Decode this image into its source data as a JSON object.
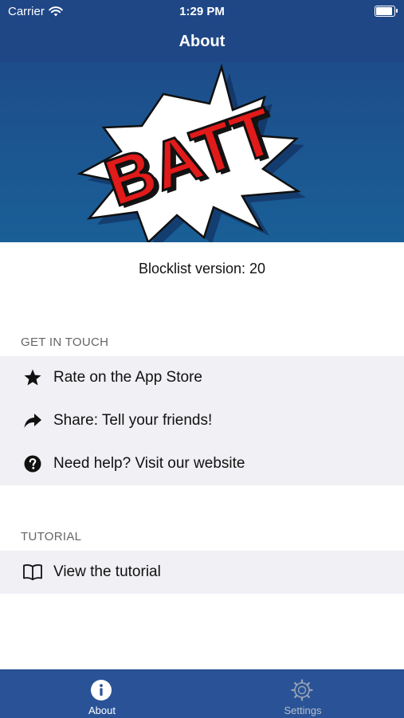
{
  "status": {
    "carrier": "Carrier",
    "time": "1:29 PM",
    "battery_level": 1.0
  },
  "nav": {
    "title": "About"
  },
  "banner": {
    "logo_text": "BATT"
  },
  "info": {
    "version_text": "Blocklist version: 20"
  },
  "sections": {
    "contact": {
      "header": "GET IN TOUCH",
      "items": [
        {
          "label": "Rate on the App Store",
          "icon": "star-icon"
        },
        {
          "label": "Share: Tell your friends!",
          "icon": "share-arrow-icon"
        },
        {
          "label": "Need help? Visit our website",
          "icon": "help-icon"
        }
      ]
    },
    "tutorial": {
      "header": "TUTORIAL",
      "items": [
        {
          "label": "View the tutorial",
          "icon": "book-icon"
        }
      ]
    }
  },
  "tabbar": {
    "tabs": [
      {
        "label": "About",
        "icon": "info-icon",
        "selected": true
      },
      {
        "label": "Settings",
        "icon": "settings-gear-icon",
        "selected": false
      }
    ]
  },
  "colors": {
    "nav_bar": "#1f4786",
    "tab_bar": "#2a5397",
    "logo_red": "#e11a1a",
    "group_background": "#f0f0f5"
  }
}
